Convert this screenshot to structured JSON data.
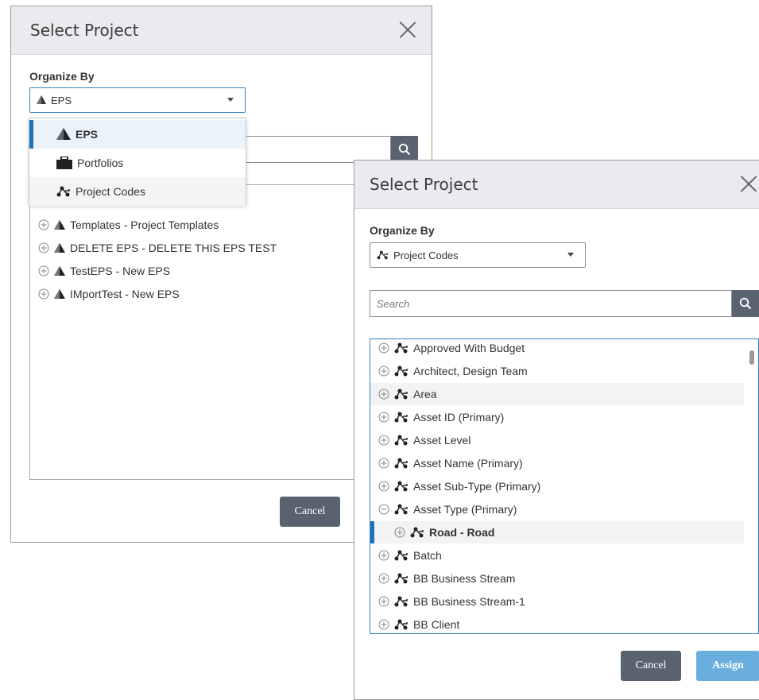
{
  "dialog1": {
    "title": "Select Project",
    "organize_label": "Organize By",
    "organize_value": "EPS",
    "dropdown_options": [
      {
        "label": "EPS",
        "icon": "eps-icon",
        "selected": true
      },
      {
        "label": "Portfolios",
        "icon": "portfolio-icon",
        "selected": false
      },
      {
        "label": "Project Codes",
        "icon": "project-codes-icon",
        "selected": false
      }
    ],
    "tree": [
      "Templates - Project Templates",
      "DELETE EPS - DELETE THIS EPS TEST",
      "TestEPS - New EPS",
      "IMportTest - New EPS"
    ],
    "cancel_label": "Cancel"
  },
  "dialog2": {
    "title": "Select Project",
    "organize_label": "Organize By",
    "organize_value": "Project Codes",
    "search_placeholder": "Search",
    "tree": [
      {
        "label": "Approved With Budget",
        "expanded": false,
        "child": false
      },
      {
        "label": "Architect, Design Team",
        "expanded": false,
        "child": false
      },
      {
        "label": "Area",
        "expanded": false,
        "child": false
      },
      {
        "label": "Asset ID (Primary)",
        "expanded": false,
        "child": false
      },
      {
        "label": "Asset Level",
        "expanded": false,
        "child": false
      },
      {
        "label": "Asset Name (Primary)",
        "expanded": false,
        "child": false
      },
      {
        "label": "Asset Sub-Type (Primary)",
        "expanded": false,
        "child": false
      },
      {
        "label": "Asset Type (Primary)",
        "expanded": true,
        "child": false
      },
      {
        "label": "Road - Road",
        "expanded": false,
        "child": true
      },
      {
        "label": "Batch",
        "expanded": false,
        "child": false
      },
      {
        "label": "BB Business Stream",
        "expanded": false,
        "child": false
      },
      {
        "label": "BB Business Stream-1",
        "expanded": false,
        "child": false
      },
      {
        "label": "BB Client",
        "expanded": false,
        "child": false
      }
    ],
    "cancel_label": "Cancel",
    "assign_label": "Assign"
  },
  "colors": {
    "header_bg": "#e9ebee",
    "accent_blue": "#1f74b8",
    "cancel_btn": "#596370",
    "assign_btn": "#6aaee0",
    "search_btn": "#5a6470"
  }
}
